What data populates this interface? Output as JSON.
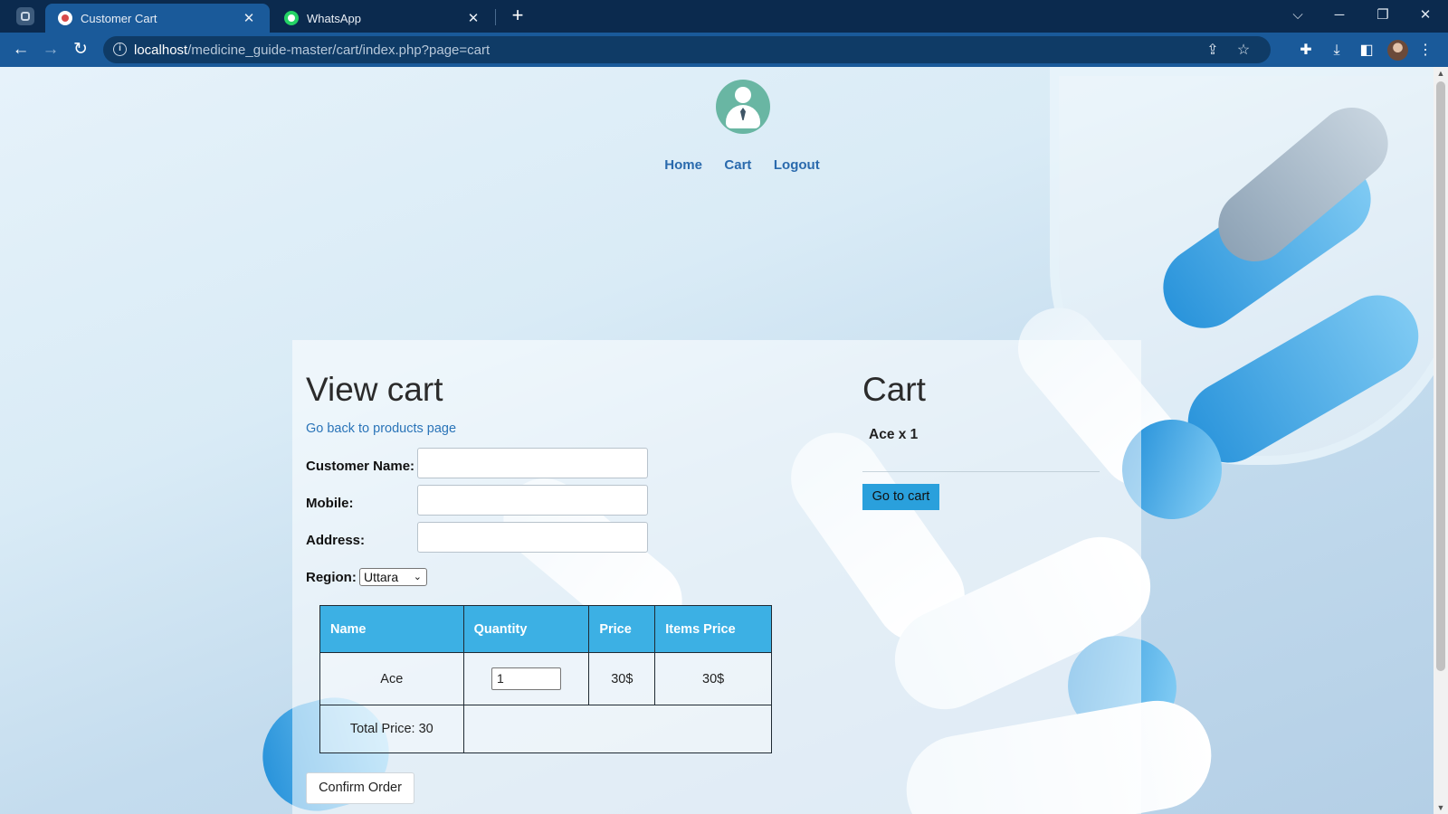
{
  "browser": {
    "tabs": [
      {
        "title": "Customer Cart",
        "active": true
      },
      {
        "title": "WhatsApp",
        "active": false
      }
    ],
    "new_tab_label": "+",
    "url_host": "localhost",
    "url_path": "/medicine_guide-master/cart/index.php?page=cart",
    "window_controls": {
      "minimize": "─",
      "restore": "❐",
      "close": "✕"
    },
    "tab_list_icon": "⌵"
  },
  "nav": {
    "items": [
      "Home",
      "Cart",
      "Logout"
    ]
  },
  "view_cart": {
    "title": "View cart",
    "back_link": "Go back to products page",
    "fields": [
      {
        "label": "Customer Name:",
        "value": ""
      },
      {
        "label": "Mobile:",
        "value": ""
      },
      {
        "label": "Address:",
        "value": ""
      }
    ],
    "region_label": "Region:",
    "region_value": "Uttara",
    "table": {
      "headers": [
        "Name",
        "Quantity",
        "Price",
        "Items Price"
      ],
      "rows": [
        {
          "name": "Ace",
          "quantity": "1",
          "price": "30$",
          "items_price": "30$"
        }
      ],
      "total": "Total Price: 30"
    },
    "confirm_label": "Confirm Order"
  },
  "cart_panel": {
    "title": "Cart",
    "item": "Ace x 1",
    "goto_label": "Go to cart"
  },
  "colors": {
    "accent": "#3cb0e4",
    "link": "#2a74b8",
    "chrome": "#1a5a9a"
  }
}
